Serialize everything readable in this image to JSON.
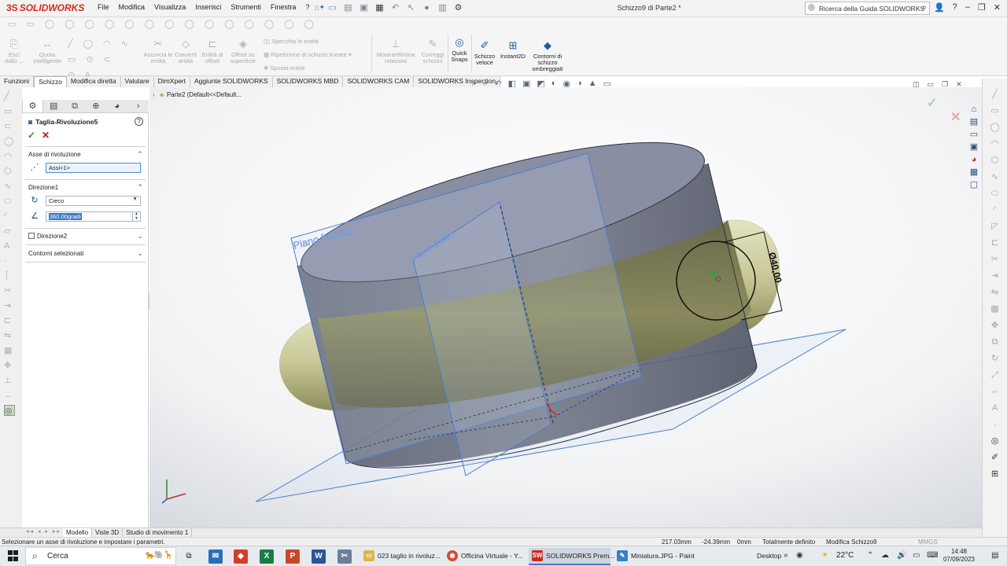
{
  "app": {
    "logo": "SOLIDWORKS",
    "menu": [
      "File",
      "Modifica",
      "Visualizza",
      "Inserisci",
      "Strumenti",
      "Finestra"
    ],
    "doc_title": "Schizzo9 di Parte2 *",
    "search_placeholder": "Ricerca della Guida SOLIDWORKS",
    "accent": "#d52b1e"
  },
  "ribbon": {
    "exit_sketch": "Esci dallo ...",
    "smart_dim": "Quota intelligente",
    "trim": "Accorcia le entità",
    "convert": "Converti entità",
    "offset": "Entità di offset",
    "offset_surface": "Offset su superficie",
    "mirror": "Specchia le entità",
    "linear_pattern": "Ripetizione di schizzo lineare",
    "move": "Sposta entità",
    "show_relations": "Mostra/elimina relazioni",
    "repair": "Correggi schizzo",
    "quick_snaps": "Quick Snaps",
    "rapid_sketch": "Schizzo veloce",
    "instant2d": "Instant2D",
    "shaded_contours": "Contorni di schizzo ombreggiati"
  },
  "tabs": [
    "Funzioni",
    "Schizzo",
    "Modifica diretta",
    "Valutare",
    "DimXpert",
    "Aggiunte SOLIDWORKS",
    "SOLIDWORKS MBD",
    "SOLIDWORKS CAM",
    "SOLIDWORKS Inspection"
  ],
  "feature_tree": {
    "breadcrumb": "Parte2  (Default<<Default..."
  },
  "property_manager": {
    "feature_name": "Taglia-Rivoluzione5",
    "axis_section": "Asse di rivoluzione",
    "axis_value": "Assi<1>",
    "dir1_section": "Direzione1",
    "end_condition": "Cieco",
    "angle_value": "360.00gradi",
    "dir2_section": "Direzione2",
    "contours_section": "Contorni selezionati"
  },
  "viewport": {
    "plane_front": "Piano frontale",
    "plane_right": "Piano destro",
    "dimension": "Ø40,00",
    "colors": {
      "cylinder": "#5f6474",
      "torus": "#c9c99a",
      "plane": "#4a7fd0"
    }
  },
  "bottom_tabs": [
    "Modello",
    "Viste 3D",
    "Studio di movimento 1"
  ],
  "status": {
    "message": "Selezionare un asse di rivoluzione e impostare i parametri.",
    "x": "217.03mm",
    "y": "-24.39mm",
    "z": "0mm",
    "state": "Totalmente definito",
    "mode": "Modifica Schizzo9",
    "units": "MMGS"
  },
  "taskbar": {
    "search": "Cerca",
    "apps": [
      {
        "label": "023 taglio in rivoluz...",
        "icon": "folder-icon",
        "color": "#e0b643"
      },
      {
        "label": "Officina Virtuale - Y...",
        "icon": "chrome-icon",
        "color": "#dc4535"
      },
      {
        "label": "SOLIDWORKS Prem...",
        "icon": "solidworks-icon",
        "color": "#c62b22"
      },
      {
        "label": "Miniatura.JPG - Paint",
        "icon": "paint-icon",
        "color": "#3a7fc4"
      }
    ],
    "desktop": "Desktop",
    "temperature": "22°C",
    "time": "14:48",
    "date": "07/09/2023"
  }
}
